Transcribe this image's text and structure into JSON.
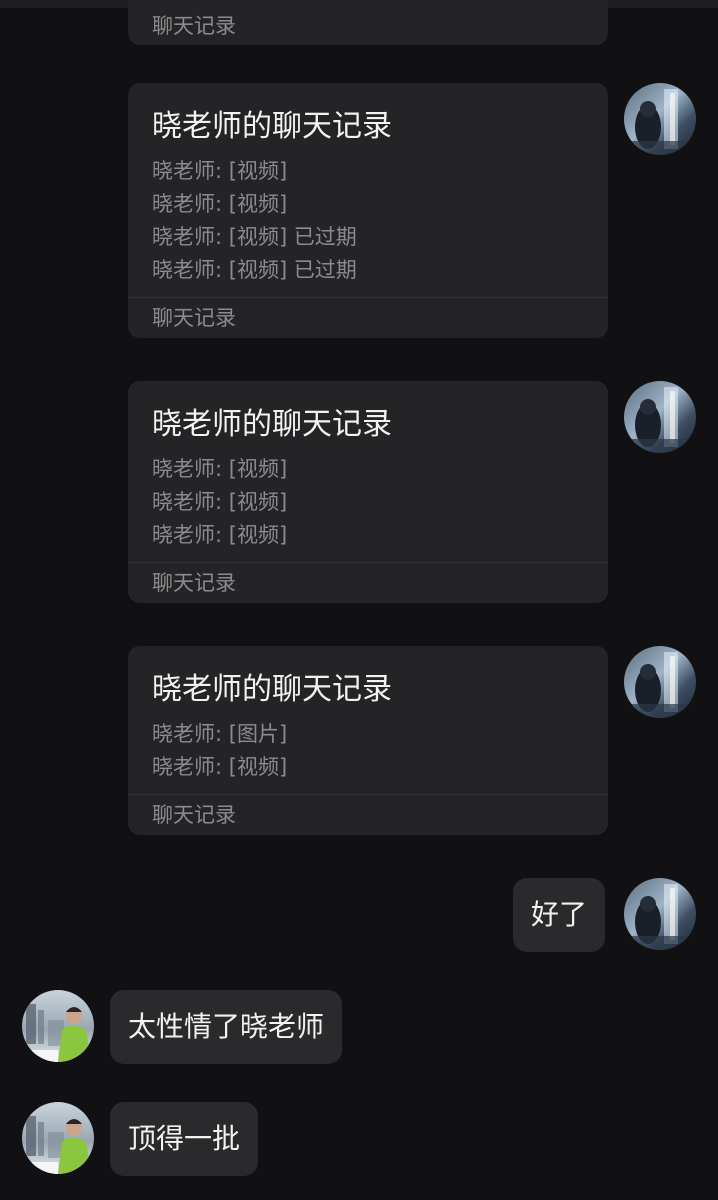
{
  "chat": {
    "partial_card": {
      "footer": "聊天记录"
    },
    "cards": [
      {
        "title": "晓老师的聊天记录",
        "lines": [
          "晓老师: [视频]",
          "晓老师: [视频]",
          "晓老师: [视频] 已过期",
          "晓老师: [视频] 已过期"
        ],
        "footer": "聊天记录"
      },
      {
        "title": "晓老师的聊天记录",
        "lines": [
          "晓老师: [视频]",
          "晓老师: [视频]",
          "晓老师: [视频]"
        ],
        "footer": "聊天记录"
      },
      {
        "title": "晓老师的聊天记录",
        "lines": [
          "晓老师: [图片]",
          "晓老师: [视频]"
        ],
        "footer": "聊天记录"
      }
    ],
    "messages": {
      "self_reply": "好了",
      "other_1": "太性情了晓老师",
      "other_2": "顶得一批"
    }
  },
  "colors": {
    "background": "#111113",
    "card": "#242426",
    "bubble": "#2a2a2c",
    "primary_text": "#f2f2f2",
    "secondary_text": "#8b8b8e"
  },
  "icons": {
    "self_avatar": "avatar-photo-lake",
    "other_avatar": "avatar-photo-snow-person"
  }
}
